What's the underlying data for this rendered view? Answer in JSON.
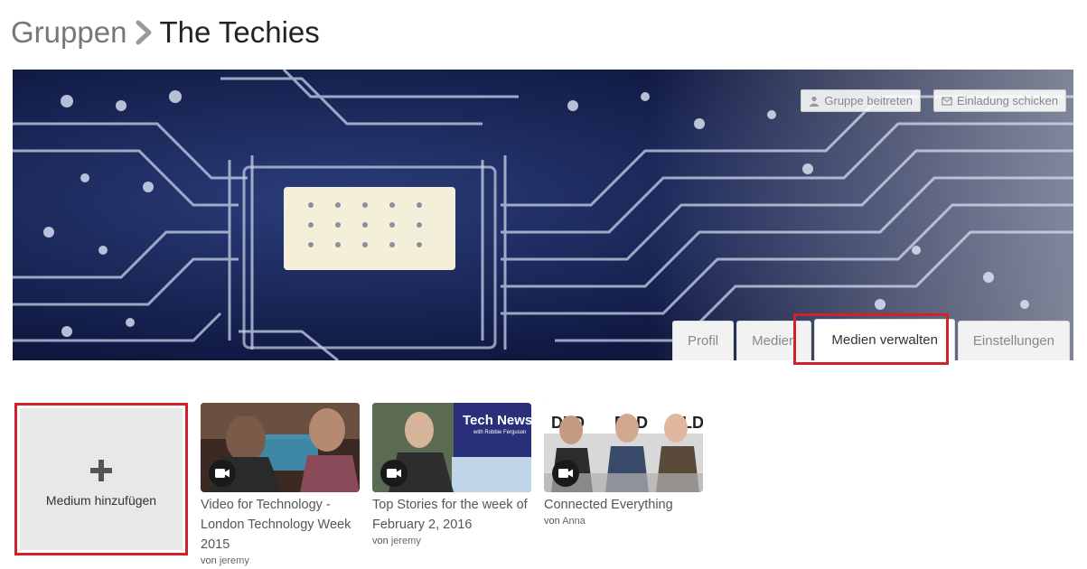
{
  "breadcrumb": {
    "parent": "Gruppen",
    "current": "The Techies"
  },
  "actions": {
    "join_label": "Gruppe beitreten",
    "invite_label": "Einladung schicken"
  },
  "tabs": [
    {
      "label": "Profil",
      "active": false
    },
    {
      "label": "Medien",
      "active": false
    },
    {
      "label": "Medien verwalten",
      "active": true
    },
    {
      "label": "Einstellungen",
      "active": false
    }
  ],
  "add_media": {
    "label": "Medium hinzufügen"
  },
  "media": [
    {
      "title": "Video for Technology - London Technology Week 2015",
      "by": "von",
      "author": "jeremy",
      "icon": "video-camera-icon"
    },
    {
      "title": "Top Stories for the week of February 2, 2016",
      "by": "von",
      "author": "jeremy",
      "icon": "video-camera-icon"
    },
    {
      "title": "Connected Everything",
      "by": "von",
      "author": "Anna",
      "icon": "video-camera-icon"
    }
  ],
  "thumb2_overlay": {
    "line1": "Tech News",
    "line2": "with Robbie Ferguson"
  },
  "thumb3_overlay": {
    "logo_text": "DLD"
  },
  "colors": {
    "highlight": "#d0222a",
    "banner_dark": "#0b1330",
    "chip": "#f3efd9"
  }
}
